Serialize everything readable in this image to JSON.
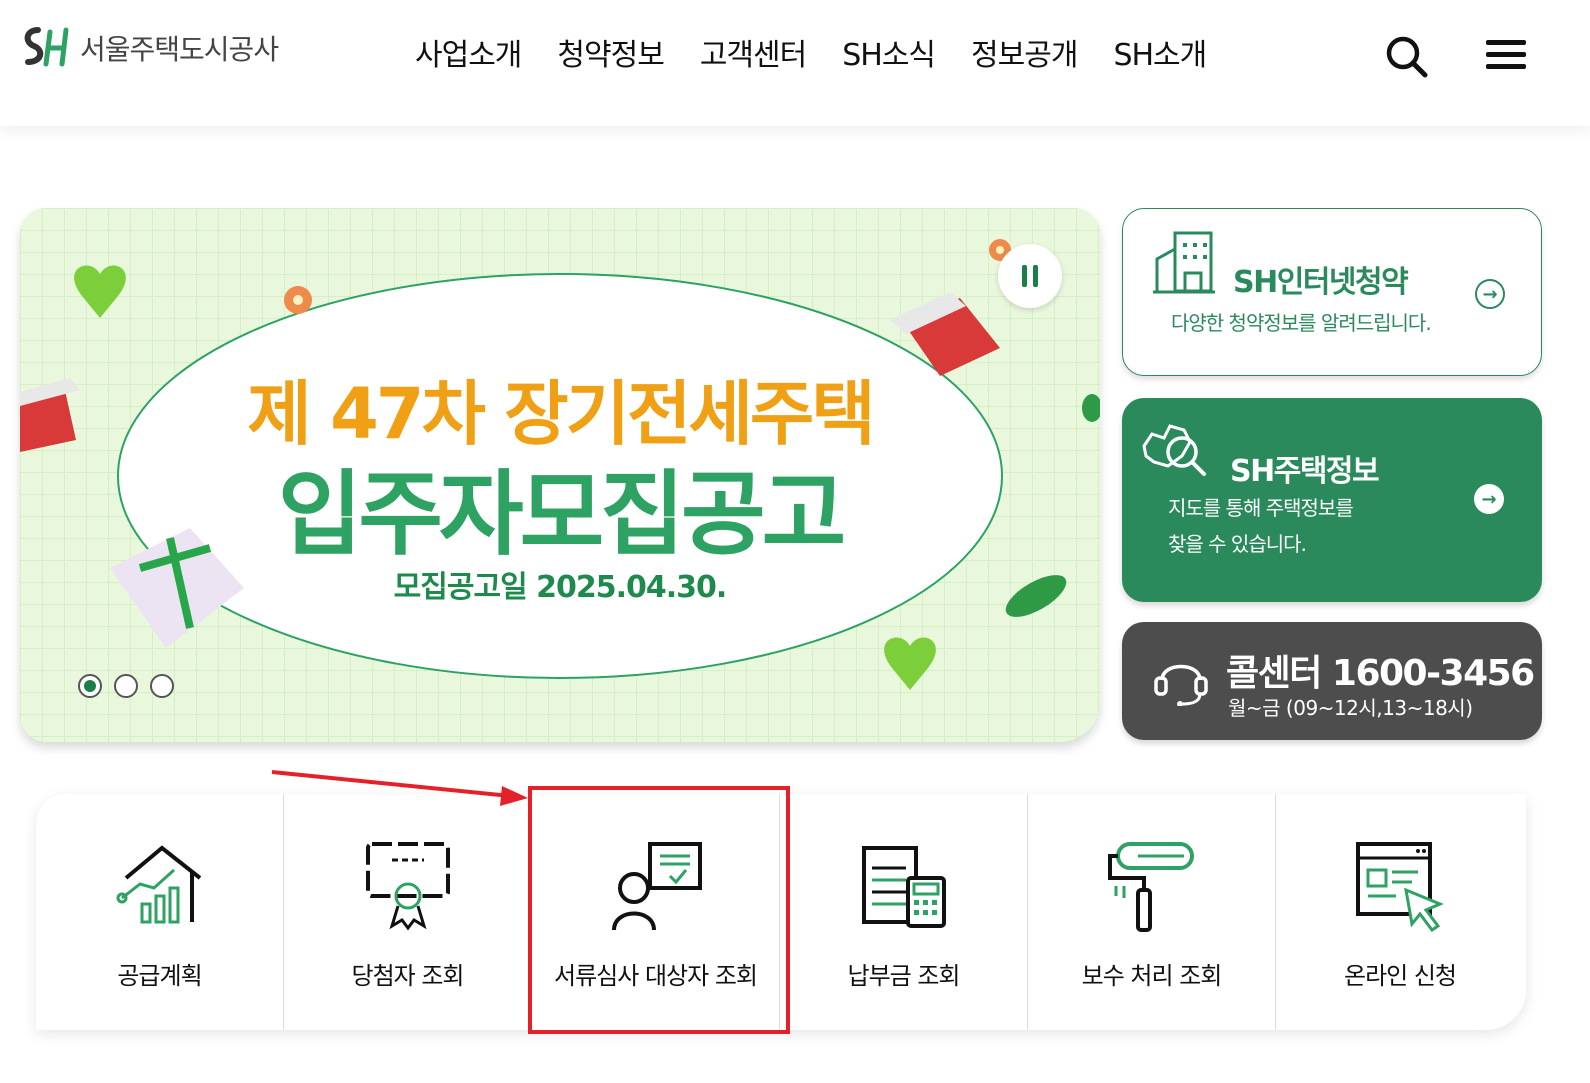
{
  "header": {
    "logo_text": "서울주택도시공사",
    "nav": [
      "사업소개",
      "청약정보",
      "고객센터",
      "SH소식",
      "정보공개",
      "SH소개"
    ],
    "search_icon": "search-icon",
    "menu_icon": "hamburger-menu-icon"
  },
  "banner": {
    "line1": "제 47차 장기전세주택",
    "line2": "입주자모집공고",
    "line3": "모집공고일 2025.04.30.",
    "slide_count": 3,
    "active_slide": 1,
    "pause_icon": "pause-icon"
  },
  "cards": {
    "internet": {
      "title": "SH인터넷청약",
      "desc": "다양한 청약정보를 알려드립니다.",
      "icon": "building-icon"
    },
    "housing": {
      "title": "SH주택정보",
      "desc_line1": "지도를 통해 주택정보를",
      "desc_line2": "찾을 수 있습니다.",
      "icon": "map-search-icon"
    },
    "callcenter": {
      "title": "콜센터 1600-3456",
      "hours": "월~금 (09~12시,13~18시)",
      "icon": "headset-icon"
    }
  },
  "quick_menu": [
    {
      "label": "공급계획",
      "icon": "house-chart-icon"
    },
    {
      "label": "당첨자 조회",
      "icon": "certificate-icon"
    },
    {
      "label": "서류심사 대상자 조회",
      "icon": "person-document-icon"
    },
    {
      "label": "납부금 조회",
      "icon": "calculator-document-icon"
    },
    {
      "label": "보수 처리 조회",
      "icon": "paint-roller-icon"
    },
    {
      "label": "온라인 신청",
      "icon": "browser-cursor-icon"
    }
  ],
  "colors": {
    "brand_green": "#2a8a5c",
    "banner_orange": "#f0a015",
    "banner_green": "#2da262",
    "annotation_red": "#e4202a"
  }
}
